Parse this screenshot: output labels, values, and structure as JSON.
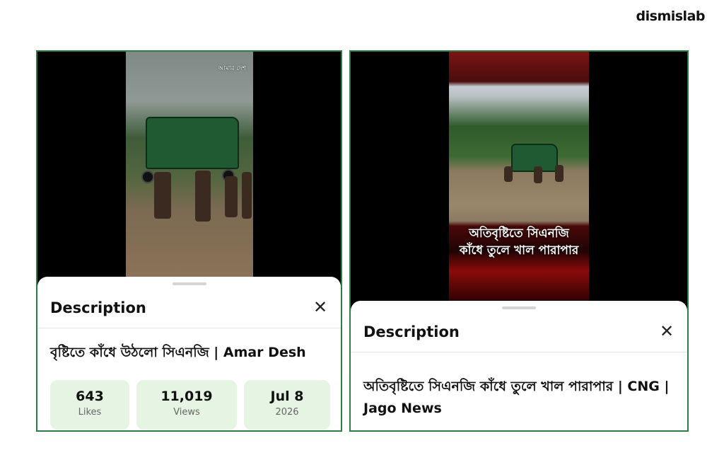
{
  "brand": "dismislab",
  "left": {
    "watermark": "আমার দেশ",
    "sheet_title": "Description",
    "description": "বৃষ্টিতে কাঁধে উঠলো সিএনজি | Amar Desh",
    "stats": [
      {
        "value": "643",
        "label": "Likes"
      },
      {
        "value": "11,019",
        "label": "Views"
      },
      {
        "value": "Jul 8",
        "label": "2026"
      }
    ]
  },
  "right": {
    "overlay_line1": "অতিবৃষ্টিতে সিএনজি",
    "overlay_line2": "কাঁধে তুলে খাল পারাপার",
    "sheet_title": "Description",
    "description": "অতিবৃষ্টিতে সিএনজি কাঁধে তুলে খাল পারাপার | CNG | Jago News"
  },
  "icons": {
    "close": "close-icon"
  },
  "colors": {
    "panel_border": "#2e7d46",
    "stat_bg": "#e6f4e3"
  }
}
